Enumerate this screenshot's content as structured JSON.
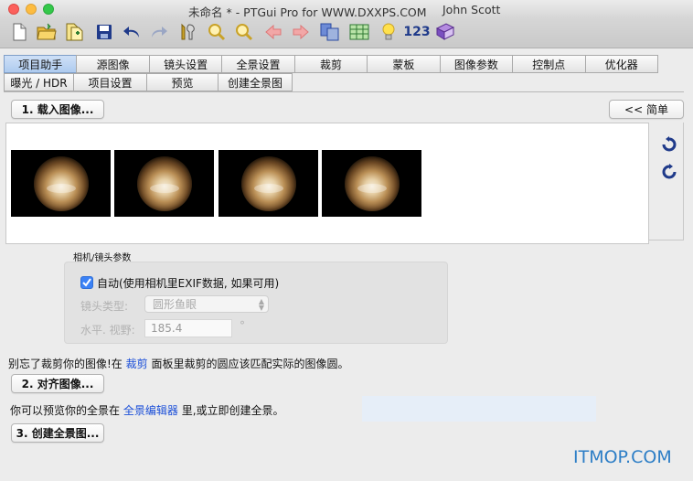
{
  "window": {
    "title": "未命名 * - PTGui Pro for WWW.DXXPS.COM",
    "user": "John Scott"
  },
  "toolbar": {
    "icons": [
      "new-document-icon",
      "open-folder-icon",
      "add-images-icon",
      "save-icon",
      "undo-icon",
      "redo-icon",
      "tools-icon",
      "zoom-in-icon",
      "zoom-out-icon",
      "previous-icon",
      "next-icon",
      "copy-icon",
      "table-icon",
      "lightbulb-icon",
      "numbers-icon",
      "help-book-icon"
    ],
    "number_label": "123"
  },
  "tabs_row1": [
    "项目助手",
    "源图像",
    "镜头设置",
    "全景设置",
    "裁剪",
    "蒙板",
    "图像参数",
    "控制点",
    "优化器"
  ],
  "tabs_row2": [
    "曝光 / HDR",
    "项目设置",
    "预览",
    "创建全景图"
  ],
  "active_tab": "项目助手",
  "buttons": {
    "load_images": "1. 载入图像...",
    "simple": "<< 简单",
    "align_images": "2. 对齐图像...",
    "create_panorama": "3. 创建全景图..."
  },
  "image_strip": {
    "thumbnail_count": 4
  },
  "camera": {
    "group_label": "相机/镜头参数",
    "auto_checked": true,
    "auto_label": "自动(使用相机里EXIF数据, 如果可用)",
    "lens_type_label": "镜头类型:",
    "lens_type_value": "圆形鱼眼",
    "fov_label": "水平. 视野:",
    "fov_value": "185.4",
    "fov_unit": "°"
  },
  "instructions": {
    "crop_prefix": "别忘了裁剪你的图像!在",
    "crop_link": "裁剪",
    "crop_suffix": "面板里裁剪的圆应该匹配实际的图像圆。",
    "preview_prefix": "你可以预览你的全景在",
    "preview_link": "全景编辑器",
    "preview_suffix": "里,或立即创建全景。"
  },
  "watermark": "ITMOP.COM",
  "colors": {
    "accent": "#3b82f6",
    "link": "#1b4fd8",
    "watermark": "#2d7ec6"
  }
}
